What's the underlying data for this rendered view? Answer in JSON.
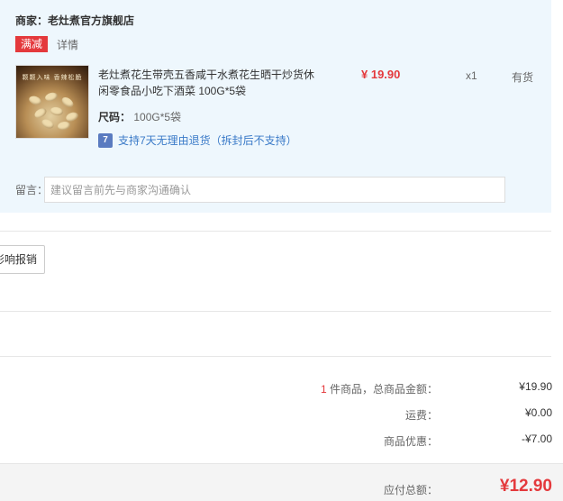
{
  "merchant": {
    "label": "商家：老灶煮官方旗舰店"
  },
  "promo": {
    "badge": "满减",
    "detail": "详情"
  },
  "item": {
    "image_caption": "颗颗入味 香辣松脆",
    "title": "老灶煮花生带壳五香咸干水煮花生晒干炒货休闲零食品小吃下酒菜 100G*5袋",
    "price": "¥ 19.90",
    "qty": "x1",
    "stock": "有货",
    "spec_label": "尺码：",
    "spec_value": "100G*5袋",
    "return_icon": "7",
    "return_text": "支持7天无理由退货（拆封后不支持）"
  },
  "message": {
    "label": "留言：",
    "placeholder": "建议留言前先与商家沟通确认",
    "value": ""
  },
  "invoice": {
    "button_label": "影响报销"
  },
  "summary": {
    "count": "1",
    "count_suffix": " 件商品，总商品金额：",
    "goods_total": "¥19.90",
    "shipping_label": "运费：",
    "shipping_value": "¥0.00",
    "discount_label": "商品优惠：",
    "discount_value": "-¥7.00"
  },
  "total": {
    "label": "应付总额：",
    "value": "¥12.90"
  },
  "colors": {
    "accent": "#e4393c",
    "panel": "#eef7fd",
    "link": "#3a7ac8"
  }
}
